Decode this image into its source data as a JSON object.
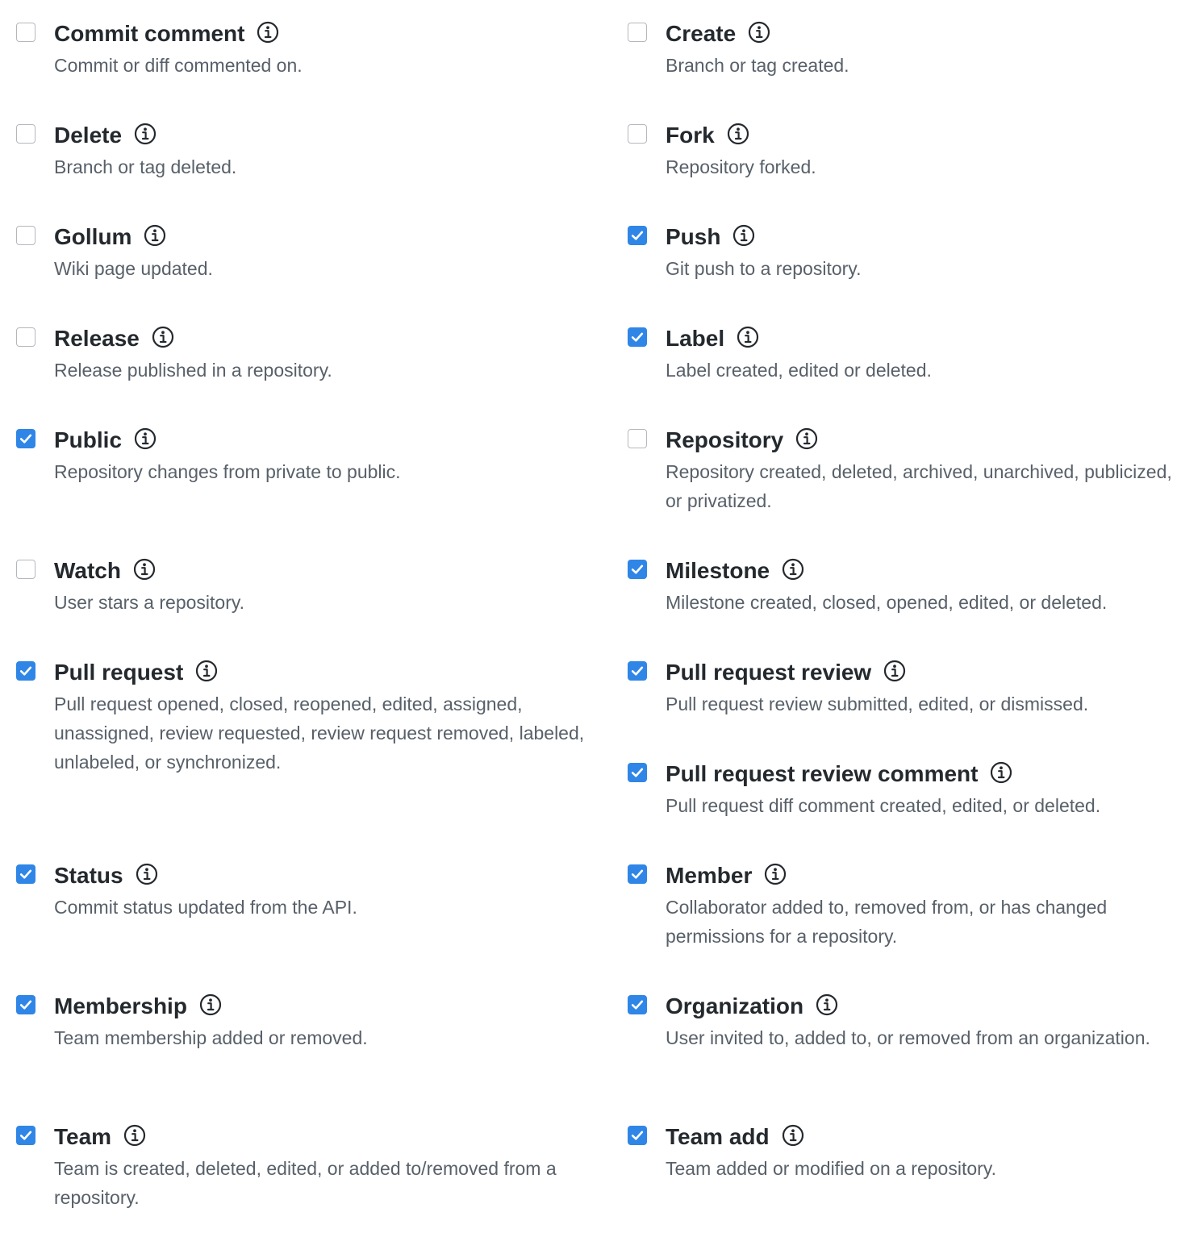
{
  "events": [
    {
      "name": "Commit comment",
      "description": "Commit or diff commented on.",
      "checked": false
    },
    {
      "name": "Create",
      "description": "Branch or tag created.",
      "checked": false
    },
    {
      "name": "Delete",
      "description": "Branch or tag deleted.",
      "checked": false
    },
    {
      "name": "Fork",
      "description": "Repository forked.",
      "checked": false
    },
    {
      "name": "Gollum",
      "description": "Wiki page updated.",
      "checked": false
    },
    {
      "name": "Push",
      "description": "Git push to a repository.",
      "checked": true
    },
    {
      "name": "Release",
      "description": "Release published in a repository.",
      "checked": false
    },
    {
      "name": "Label",
      "description": "Label created, edited or deleted.",
      "checked": true
    },
    {
      "name": "Public",
      "description": "Repository changes from private to public.",
      "checked": true
    },
    {
      "name": "Repository",
      "description": "Repository created, deleted, archived, unarchived, publicized, or privatized.",
      "checked": false
    },
    {
      "name": "Watch",
      "description": "User stars a repository.",
      "checked": false
    },
    {
      "name": "Milestone",
      "description": "Milestone created, closed, opened, edited, or deleted.",
      "checked": true
    },
    {
      "name": "Pull request",
      "description": "Pull request opened, closed, reopened, edited, assigned, unassigned, review requested, review request removed, labeled, unlabeled, or synchronized.",
      "checked": true
    },
    {
      "name": "Pull request review",
      "description": "Pull request review submitted, edited, or dismissed.",
      "checked": true
    },
    {
      "name": "Pull request review comment",
      "description": "Pull request diff comment created, edited, or deleted.",
      "checked": true
    },
    {
      "name": "Status",
      "description": "Commit status updated from the API.",
      "checked": true
    },
    {
      "name": "Member",
      "description": "Collaborator added to, removed from, or has changed permissions for a repository.",
      "checked": true
    },
    {
      "name": "Membership",
      "description": "Team membership added or removed.",
      "checked": true
    },
    {
      "name": "Organization",
      "description": "User invited to, added to, or removed from an organization.",
      "checked": true
    },
    {
      "name": "Team",
      "description": "Team is created, deleted, edited, or added to/removed from a repository.",
      "checked": true
    },
    {
      "name": "Team add",
      "description": "Team added or modified on a repository.",
      "checked": true
    }
  ],
  "colors": {
    "checked_fill": "#2f86e6",
    "unchecked_border": "#b4b8bd",
    "title": "#24292e",
    "description": "#586069",
    "info_icon": "#24292e"
  },
  "icons": {
    "check": "checkmark-icon",
    "info": "info-icon"
  }
}
